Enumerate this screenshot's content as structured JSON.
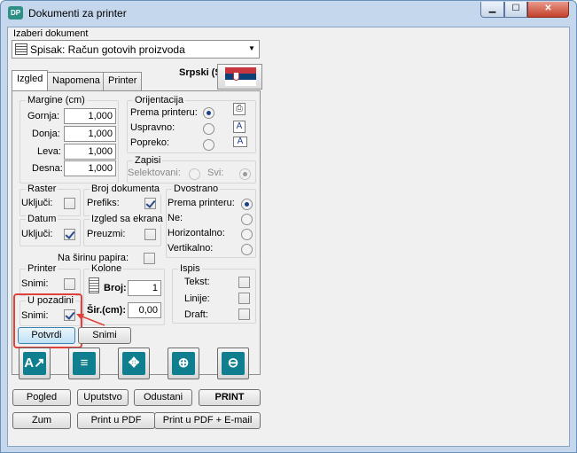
{
  "window": {
    "title": "Dokumenti za printer",
    "app_icon": "DP",
    "min_icon": "▁",
    "max_icon": "☐",
    "close_icon": "✕"
  },
  "document": {
    "label": "Izaberi dokument",
    "selected": "Spisak: Račun gotovih proizvoda",
    "arrow": "▼"
  },
  "language": {
    "label": "Srpski (Srbija)"
  },
  "tabs": [
    {
      "label": "Izgled"
    },
    {
      "label": "Napomena"
    },
    {
      "label": "Printer"
    }
  ],
  "margins": {
    "title": "Margine (cm)",
    "rows": [
      {
        "label": "Gornja:",
        "value": "1,000"
      },
      {
        "label": "Donja:",
        "value": "1,000"
      },
      {
        "label": "Leva:",
        "value": "1,000"
      },
      {
        "label": "Desna:",
        "value": "1,000"
      }
    ]
  },
  "orientation": {
    "title": "Orijentacija",
    "options": [
      {
        "label": "Prema printeru:",
        "checked": true
      },
      {
        "label": "Uspravno:",
        "checked": false
      },
      {
        "label": "Popreko:",
        "checked": false
      }
    ]
  },
  "records": {
    "title": "Zapisi",
    "selected_label": "Selektovani:",
    "all_label": "Svi:"
  },
  "raster": {
    "title": "Raster",
    "enable_label": "Uključi:",
    "checked": false
  },
  "doc_number": {
    "title": "Broj dokumenta",
    "prefix_label": "Prefiks:",
    "checked": true
  },
  "duplex": {
    "title": "Dvostrano",
    "options": [
      {
        "label": "Prema printeru:",
        "checked": true
      },
      {
        "label": "Ne:",
        "checked": false
      },
      {
        "label": "Horizontalno:",
        "checked": false
      },
      {
        "label": "Vertikalno:",
        "checked": false
      }
    ]
  },
  "date": {
    "title": "Datum",
    "enable_label": "Uključi:",
    "checked": true
  },
  "screen_look": {
    "title": "Izgled sa ekrana",
    "take_label": "Preuzmi:",
    "checked": false
  },
  "paper_width": {
    "label": "Na širinu papira:",
    "checked": false
  },
  "printer_group": {
    "title": "Printer",
    "save_label": "Snimi:",
    "checked": false
  },
  "background": {
    "title": "U pozadini",
    "save_label": "Snimi:",
    "checked": true
  },
  "columns": {
    "title": "Kolone",
    "count_label": "Broj:",
    "count_value": "1",
    "width_label": "Šir.(cm):",
    "width_value": "0,00"
  },
  "print_group": {
    "title": "Ispis",
    "options": [
      {
        "label": "Tekst:",
        "checked": false
      },
      {
        "label": "Linije:",
        "checked": false
      },
      {
        "label": "Draft:",
        "checked": false
      }
    ]
  },
  "buttons": {
    "confirm": "Potvrdi",
    "save": "Snimi",
    "preview": "Pogled",
    "instructions": "Uputstvo",
    "cancel": "Odustani",
    "print": "PRINT",
    "zoom": "Zum",
    "print_pdf": "Print u PDF",
    "print_pdf_email": "Print u PDF  + E-mail"
  },
  "tool_icons": [
    "A↗",
    "≡",
    "✥",
    "⊕",
    "⊖"
  ],
  "colors": {
    "highlight": "#e0413a",
    "teal": "#0f7f8f"
  }
}
